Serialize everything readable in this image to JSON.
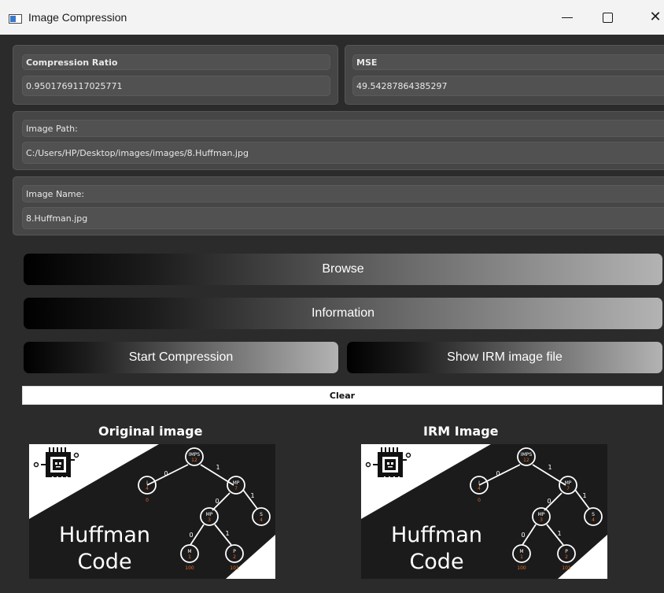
{
  "window": {
    "title": "Image Compression",
    "close_glyph": "✕"
  },
  "metrics": {
    "compression_label": "Compression Ratio",
    "compression_value": "0.9501769117025771",
    "mse_label": "MSE",
    "mse_value": "49.54287864385297"
  },
  "image_path": {
    "label": "Image Path:",
    "value": "C:/Users/HP/Desktop/images/images/8.Huffman.jpg"
  },
  "image_name": {
    "label": "Image Name:",
    "value": "8.Huffman.jpg"
  },
  "buttons": {
    "browse": "Browse",
    "information": "Information",
    "start": "Start Compression",
    "show_irm": "Show IRM  image file",
    "clear": "Clear"
  },
  "previews": {
    "original_title": "Original image",
    "irm_title": "IRM Image",
    "art_line1": "Huffman",
    "art_line2": "Code",
    "tree_nodes": [
      {
        "label": "IMPS",
        "count": "12"
      },
      {
        "label": "I",
        "count": "4"
      },
      {
        "label": "MP",
        "count": "7"
      },
      {
        "label": "MP",
        "count": "3"
      },
      {
        "label": "S",
        "count": "4"
      },
      {
        "label": "M",
        "count": "1"
      },
      {
        "label": "P",
        "count": "2"
      }
    ],
    "codes": [
      "0",
      "100",
      "101"
    ],
    "edge_bits": [
      "0",
      "1",
      "0",
      "1",
      "0",
      "1"
    ]
  },
  "colors": {
    "background": "#2b2b2b",
    "panel": "#464646",
    "field": "#515151",
    "node_count": "#e06d2c"
  }
}
